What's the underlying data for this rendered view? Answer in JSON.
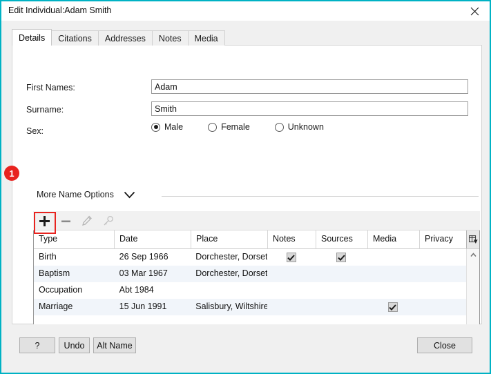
{
  "window": {
    "title": "Edit Individual:Adam Smith",
    "close_icon": "close-icon",
    "border_color": "#00b2c4"
  },
  "tabs": [
    {
      "label": "Details",
      "active": true
    },
    {
      "label": "Citations",
      "active": false
    },
    {
      "label": "Addresses",
      "active": false
    },
    {
      "label": "Notes",
      "active": false
    },
    {
      "label": "Media",
      "active": false
    }
  ],
  "form": {
    "first_names": {
      "label": "First Names:",
      "value": "Adam",
      "placeholder": ""
    },
    "surname": {
      "label": "Surname:",
      "value": "Smith",
      "placeholder": ""
    },
    "sex": {
      "label": "Sex:",
      "options": [
        {
          "label": "Male",
          "selected": true
        },
        {
          "label": "Female",
          "selected": false
        },
        {
          "label": "Unknown",
          "selected": false
        }
      ]
    },
    "more_name_options": {
      "label": "More Name Options",
      "icon": "chevron-down-icon"
    }
  },
  "annotation": {
    "badge_number": "1",
    "badge_color": "#e8231f",
    "highlight_color": "#e8231f",
    "target": "add-event-button"
  },
  "event_toolbar": [
    {
      "name": "add-event-button",
      "icon": "plus-icon",
      "enabled": true
    },
    {
      "name": "remove-event-button",
      "icon": "minus-icon",
      "enabled": true
    },
    {
      "name": "edit-event-button",
      "icon": "pencil-icon",
      "enabled": false
    },
    {
      "name": "search-event-button",
      "icon": "key-icon",
      "enabled": false
    }
  ],
  "events_grid": {
    "columns": [
      "Type",
      "Date",
      "Place",
      "Notes",
      "Sources",
      "Media",
      "Privacy"
    ],
    "column_picker_icon": "column-picker-icon",
    "rows": [
      {
        "type": "Birth",
        "date": "26 Sep 1966",
        "place": "Dorchester, Dorset",
        "notes": true,
        "sources": true,
        "media": false,
        "privacy": false
      },
      {
        "type": "Baptism",
        "date": "03 Mar 1967",
        "place": "Dorchester, Dorset",
        "notes": false,
        "sources": false,
        "media": false,
        "privacy": false
      },
      {
        "type": "Occupation",
        "date": "Abt 1984",
        "place": "",
        "notes": false,
        "sources": false,
        "media": false,
        "privacy": false
      },
      {
        "type": "Marriage",
        "date": "15 Jun 1991",
        "place": "Salisbury, Wiltshire",
        "notes": false,
        "sources": false,
        "media": true,
        "privacy": false
      }
    ],
    "scrollbar": {
      "up_icon": "scroll-up-icon",
      "down_icon": "scroll-down-icon"
    }
  },
  "footer": {
    "help_label": "?",
    "undo_label": "Undo",
    "alt_name_label": "Alt Name",
    "close_label": "Close"
  }
}
